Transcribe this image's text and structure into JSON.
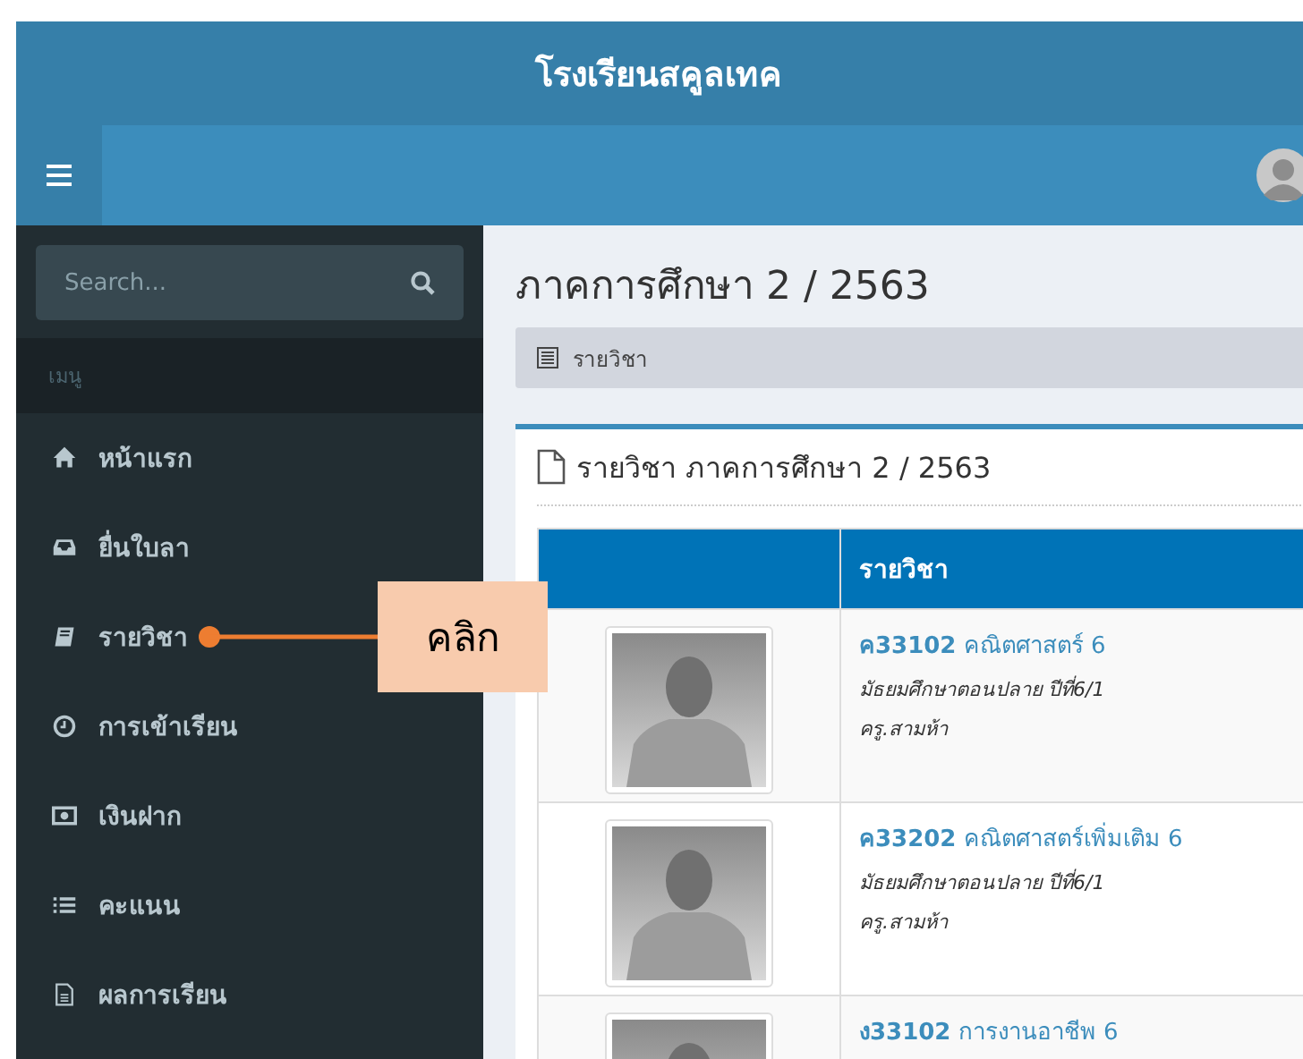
{
  "header": {
    "title": "โรงเรียนสคูลเทค"
  },
  "sidebar": {
    "search": {
      "placeholder": "Search..."
    },
    "menu_header": "เมนู",
    "items": [
      {
        "label": "หน้าแรก"
      },
      {
        "label": "ยื่นใบลา"
      },
      {
        "label": "รายวิชา",
        "callout": "คลิก"
      },
      {
        "label": "การเข้าเรียน"
      },
      {
        "label": "เงินฝาก"
      },
      {
        "label": "คะแนน"
      },
      {
        "label": "ผลการเรียน"
      }
    ]
  },
  "content": {
    "title": "ภาคการศึกษา 2 / 2563",
    "breadcrumb": "รายวิชา",
    "box_title": "รายวิชา ภาคการศึกษา 2 / 2563",
    "table": {
      "columns": [
        "รายวิชา"
      ],
      "rows": [
        {
          "course": "**ค33102** คณิตศาสตร์ 6",
          "level": "มัธยมศึกษาตอนปลาย ปีที่6/1",
          "teacher": "ครู.สามห้า"
        },
        {
          "course": "**ค33202** คณิตศาสตร์เพิ่มเติม 6",
          "level": "มัธยมศึกษาตอนปลาย ปีที่6/1",
          "teacher": "ครู.สามห้า"
        },
        {
          "course": "**ง33102** การงานอาชีพ 6"
        }
      ]
    }
  }
}
